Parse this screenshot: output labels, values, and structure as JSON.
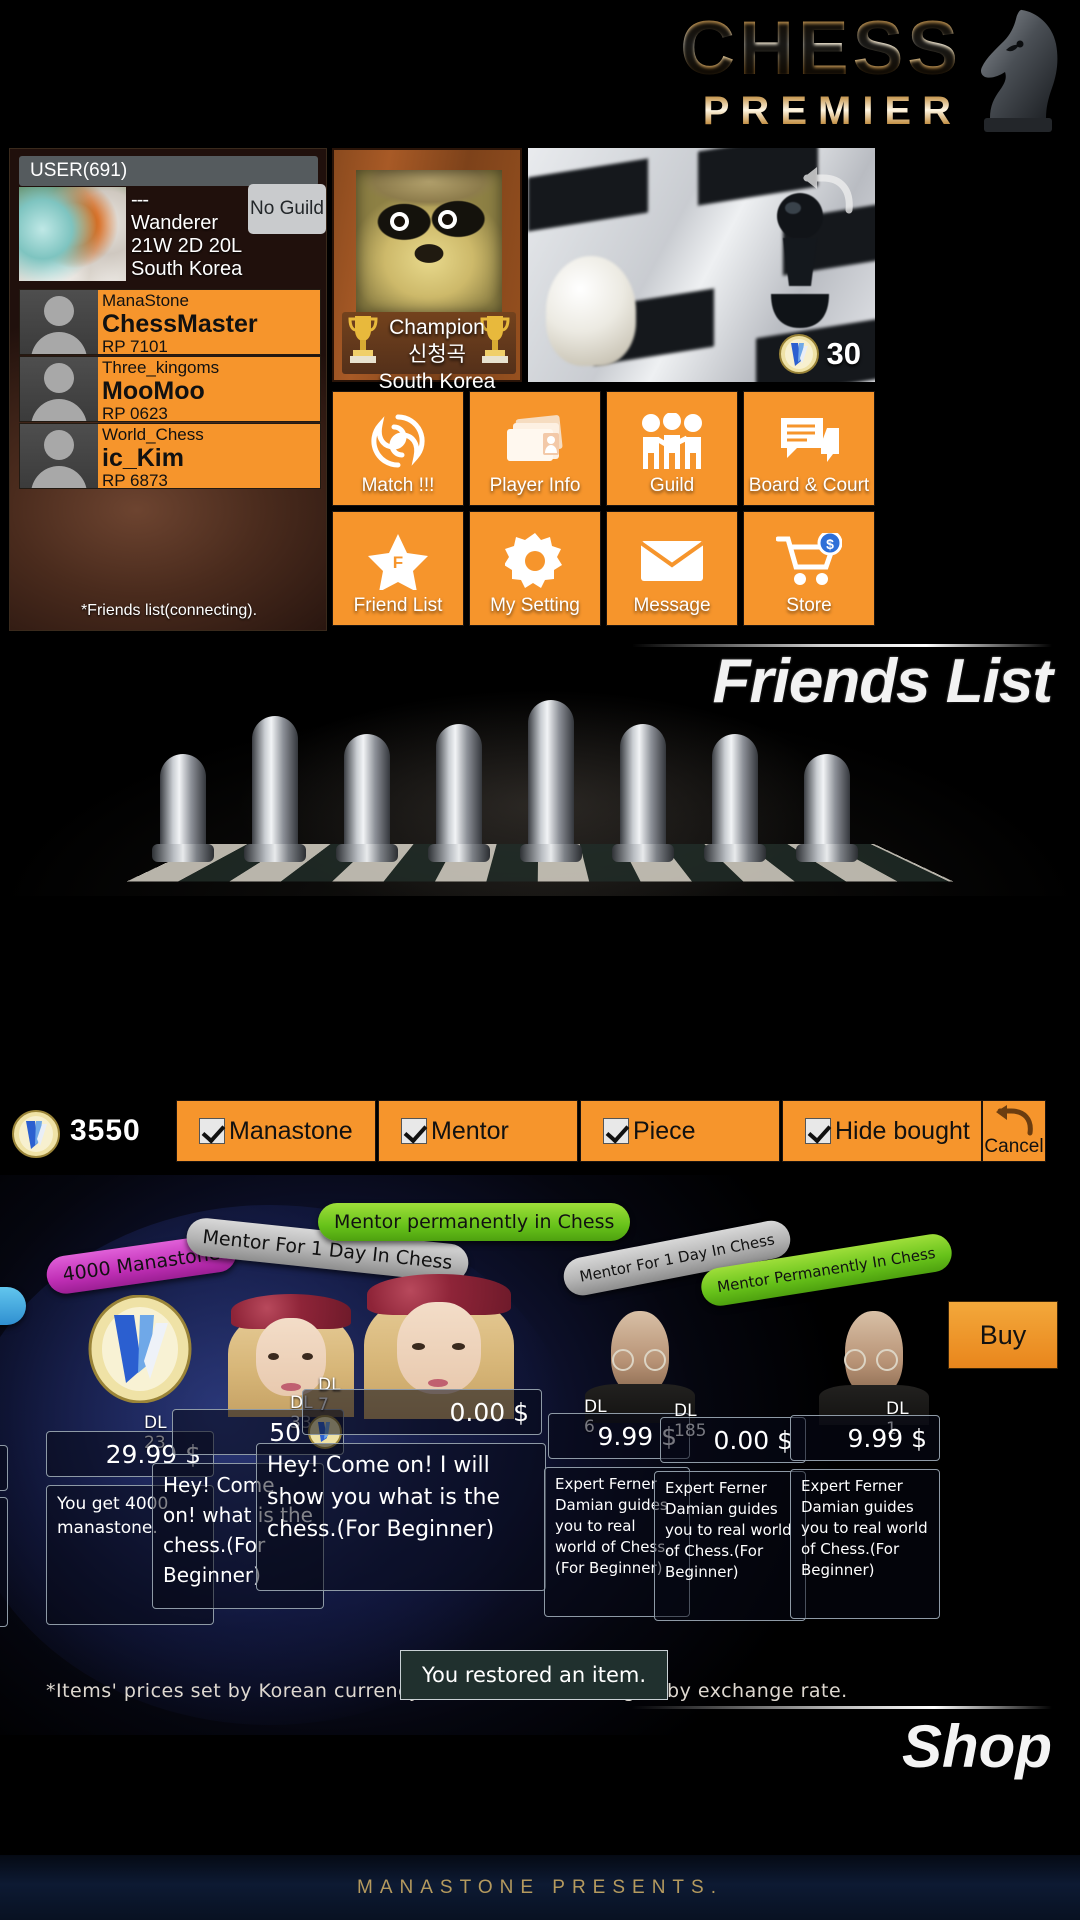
{
  "logo": {
    "title_top": "CHESS",
    "title_bottom": "PREMIER",
    "knight_icon": "knight-icon"
  },
  "user": {
    "tab_label": "USER(691)",
    "dash": "---",
    "rank": "Wanderer",
    "record": "21W 2D 20L",
    "country": "South Korea",
    "guild_button": "No Guild"
  },
  "friends": {
    "status": "*Friends list(connecting).",
    "items": [
      {
        "guild": "ManaStone",
        "name": "ChessMaster",
        "rp": "RP 7101"
      },
      {
        "guild": "Three_kingoms",
        "name": "MooMoo",
        "rp": "RP 0623"
      },
      {
        "guild": "World_Chess",
        "name": "ic_Kim",
        "rp": "RP 6873"
      }
    ]
  },
  "champion": {
    "label": "Champion",
    "name": "신청곡",
    "country": "South Korea",
    "trophy_icon": "trophy-icon"
  },
  "board_preview": {
    "undo_icon": "undo-arrow-icon",
    "mana_icon": "manastone-coin-icon",
    "mana_value": "30"
  },
  "menu": {
    "items": [
      {
        "label": "Match !!!",
        "icon": "swirl-icon"
      },
      {
        "label": "Player Info",
        "icon": "folder-card-icon"
      },
      {
        "label": "Guild",
        "icon": "people-group-icon"
      },
      {
        "label": "Board & Court",
        "icon": "speech-board-icon"
      },
      {
        "label": "Friend List",
        "icon": "star-icon"
      },
      {
        "label": "My Setting",
        "icon": "gear-icon"
      },
      {
        "label": "Message",
        "icon": "envelope-icon"
      },
      {
        "label": "Store",
        "icon": "shopping-cart-icon"
      }
    ]
  },
  "friends_banner": {
    "title": "Friends List"
  },
  "shop_filter": {
    "coin_icon": "manastone-coin-icon",
    "amount": "3550",
    "checkboxes": [
      {
        "label": "Manastone",
        "checked": true
      },
      {
        "label": "Mentor",
        "checked": true
      },
      {
        "label": "Piece",
        "checked": true
      },
      {
        "label": "Hide bought",
        "checked": true
      }
    ],
    "cancel_label": "Cancel",
    "cancel_icon": "undo-arrow-icon"
  },
  "shop": {
    "items": [
      {
        "ribbon": "4000 Manastone",
        "ribbon_color": "magenta",
        "dl": "DL 23",
        "price": "29.99 $",
        "desc": "You get 4000 manastone.",
        "art": "manastone-coin-icon"
      },
      {
        "ribbon": "Mentor For 1 Day In Chess",
        "ribbon_color": "gray",
        "dl": "DL 33",
        "price": "50",
        "price_icon": "manastone-coin-icon",
        "desc": "Hey! Come on! what is the chess.(For Beginner)",
        "art": "female-mentor-portrait"
      },
      {
        "ribbon": "Mentor permanently in Chess",
        "ribbon_color": "green",
        "dl": "DL 7",
        "price": "0.00 $",
        "desc": "Hey! Come on! I will show you what is the chess.(For Beginner)",
        "art": "female-mentor-portrait"
      },
      {
        "ribbon": "Mentor For 1 Day In Chess",
        "ribbon_color": "gray",
        "dl": "DL 6",
        "price": "9.99 $",
        "desc": "Expert Ferner Damian guides you to real world of Chess.(For Beginner)",
        "art": "male-mentor-portrait"
      },
      {
        "ribbon": "Mentor Permanently In Chess",
        "ribbon_color": "green",
        "dl": "DL 185",
        "price": "0.00 $",
        "desc": "Expert Ferner Damian guides you to real world of Chess.(For Beginner)",
        "art": "male-mentor-portrait"
      },
      {
        "ribbon": "",
        "ribbon_color": "green",
        "dl": "DL 1",
        "price": "9.99 $",
        "desc": "Expert Ferner Damian guides you to real world of Chess.(For Beginner)",
        "art": "male-mentor-portrait"
      }
    ],
    "buy_label": "Buy",
    "toast": "You restored an item.",
    "footnote": "*Items' prices set by Korean currency, so it could be changed by exchange rate.",
    "title": "Shop"
  },
  "footer": {
    "text": "MANASTONE PRESENTS."
  },
  "colors": {
    "accent": "#f6952c",
    "gold": "#b59a5e",
    "panel": "#555b5e"
  }
}
